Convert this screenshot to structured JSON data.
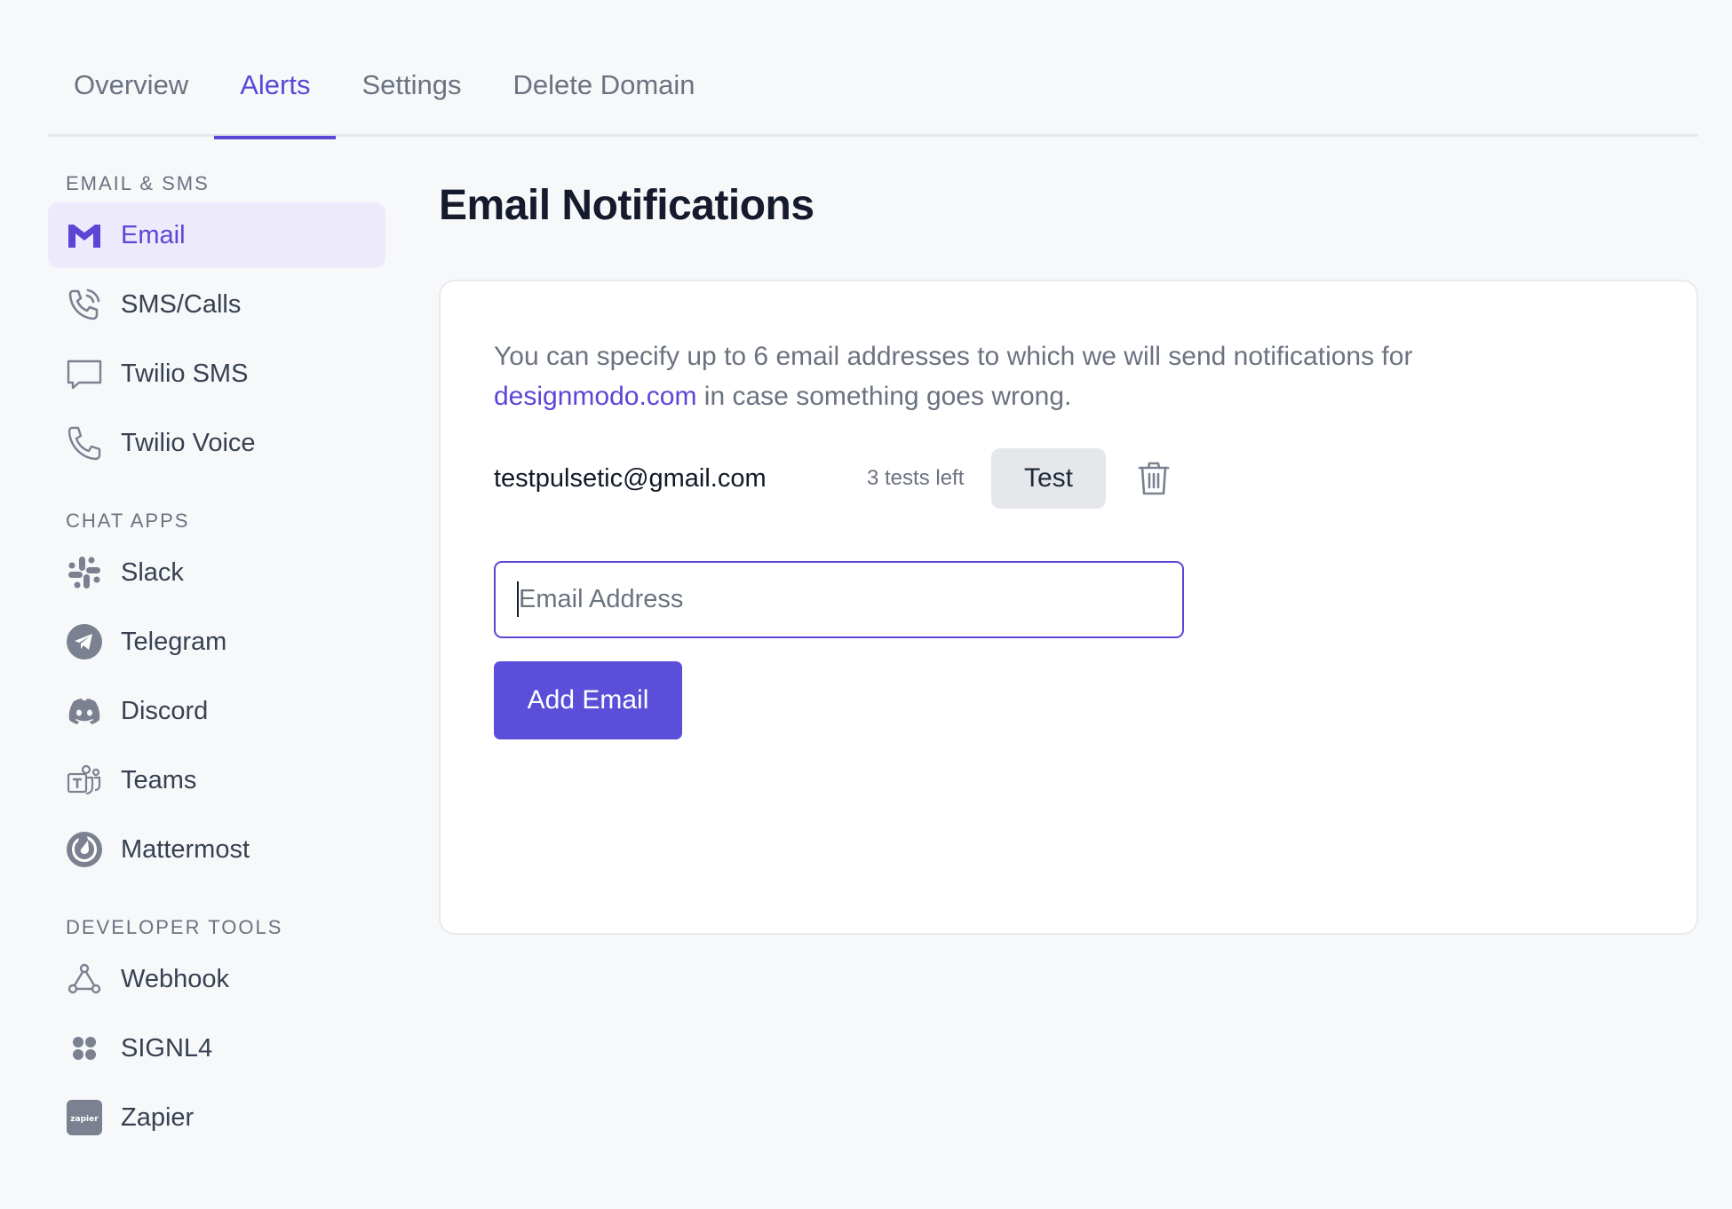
{
  "tabs": [
    {
      "label": "Overview",
      "active": false
    },
    {
      "label": "Alerts",
      "active": true
    },
    {
      "label": "Settings",
      "active": false
    },
    {
      "label": "Delete Domain",
      "active": false
    }
  ],
  "sidebar": {
    "sections": [
      {
        "title": "EMAIL & SMS",
        "items": [
          {
            "label": "Email",
            "icon": "gmail-icon",
            "active": true
          },
          {
            "label": "SMS/Calls",
            "icon": "phone-calls-icon"
          },
          {
            "label": "Twilio SMS",
            "icon": "chat-bubble-icon"
          },
          {
            "label": "Twilio Voice",
            "icon": "phone-icon"
          }
        ]
      },
      {
        "title": "CHAT APPS",
        "items": [
          {
            "label": "Slack",
            "icon": "slack-icon"
          },
          {
            "label": "Telegram",
            "icon": "telegram-icon"
          },
          {
            "label": "Discord",
            "icon": "discord-icon"
          },
          {
            "label": "Teams",
            "icon": "teams-icon"
          },
          {
            "label": "Mattermost",
            "icon": "mattermost-icon"
          }
        ]
      },
      {
        "title": "DEVELOPER TOOLS",
        "items": [
          {
            "label": "Webhook",
            "icon": "webhook-icon"
          },
          {
            "label": "SIGNL4",
            "icon": "signl4-icon"
          },
          {
            "label": "Zapier",
            "icon": "zapier-icon",
            "icon_text": "zapier"
          }
        ]
      }
    ]
  },
  "main": {
    "title": "Email Notifications",
    "description_before": "You can specify up to 6 email addresses to which we will send notifications for ",
    "description_domain": "designmodo.com",
    "description_after": " in case something goes wrong.",
    "emails": [
      {
        "address": "testpulsetic@gmail.com",
        "tests_left": "3 tests left",
        "test_label": "Test"
      }
    ],
    "input_placeholder": "Email Address",
    "input_value": "",
    "add_button_label": "Add Email"
  },
  "colors": {
    "accent": "#5b46d6",
    "background": "#f7f8fa",
    "card": "#ffffff",
    "muted_text": "#6b7280"
  }
}
